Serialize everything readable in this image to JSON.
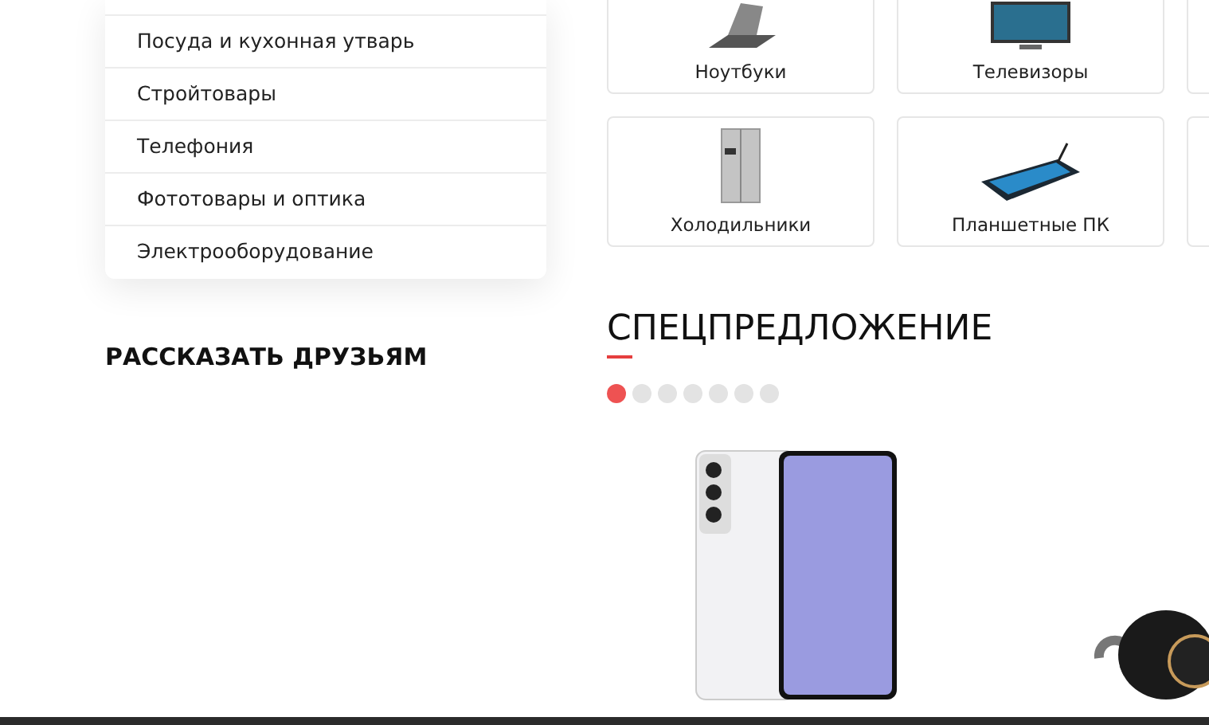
{
  "menu": {
    "items": [
      {
        "label": "Посуда и кухонная утварь"
      },
      {
        "label": "Стройтовары"
      },
      {
        "label": "Телефония"
      },
      {
        "label": "Фототовары и оптика"
      },
      {
        "label": "Электрооборудование"
      }
    ]
  },
  "share": {
    "title": "РАССКАЗАТЬ ДРУЗЬЯМ"
  },
  "categories": [
    {
      "label": "Ноутбуки",
      "kind": "laptop"
    },
    {
      "label": "Телевизоры",
      "kind": "tv"
    },
    {
      "label": "Холодильники",
      "kind": "fridge"
    },
    {
      "label": "Планшетные ПК",
      "kind": "tablet"
    }
  ],
  "special": {
    "title": "СПЕЦПРЕДЛОЖЕНИЕ",
    "slides": [
      {
        "selected": true
      },
      {
        "selected": false
      },
      {
        "selected": false
      },
      {
        "selected": false
      },
      {
        "selected": false
      },
      {
        "selected": false
      },
      {
        "selected": false
      }
    ],
    "products": [
      {
        "kind": "phone"
      },
      {
        "kind": "vacuum"
      }
    ]
  }
}
